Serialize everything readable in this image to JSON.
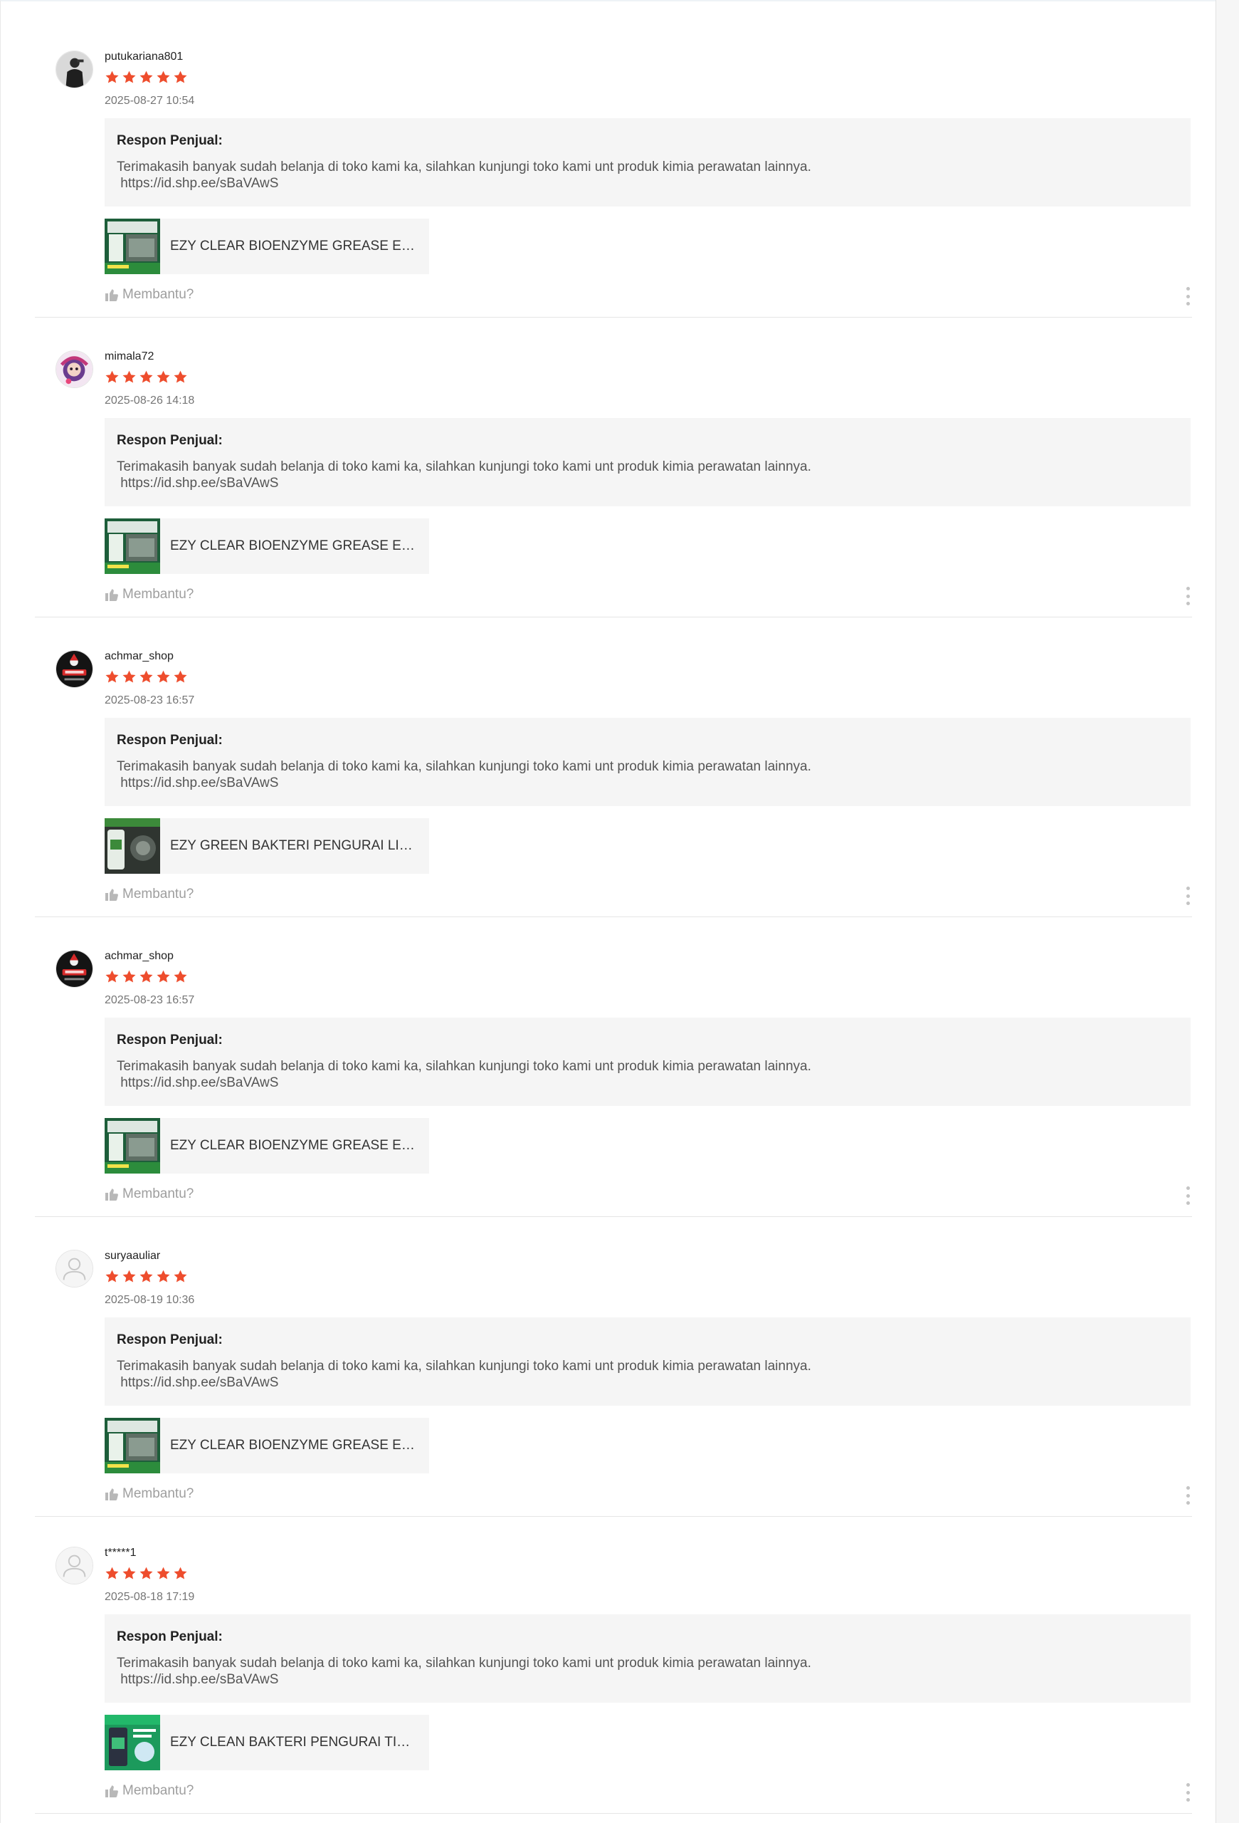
{
  "colors": {
    "star": "#ee4d2d",
    "response_bg": "#f5f5f5",
    "divider": "#e5e5e5",
    "muted_text": "#9e9e9e"
  },
  "reviews": [
    {
      "username": "putukariana801",
      "rating": 5,
      "timestamp": "2025-08-27 10:54",
      "response_title": "Respon Penjual:",
      "response_text": "Terimakasih banyak sudah belanja di toko kami ka, silahkan kunjungi toko kami unt produk kimia perawatan lainnya.\n https://id.shp.ee/sBaVAwS",
      "product_name": "EZY CLEAR BIOENZYME GREASE EATER",
      "helpful_label": "Membantu?",
      "avatar_icon": "person-photo-icon",
      "thumb_icon": "product-ezy-clear-icon"
    },
    {
      "username": "mimala72",
      "rating": 5,
      "timestamp": "2025-08-26 14:18",
      "response_title": "Respon Penjual:",
      "response_text": "Terimakasih banyak sudah belanja di toko kami ka, silahkan kunjungi toko kami unt produk kimia perawatan lainnya.\n https://id.shp.ee/sBaVAwS",
      "product_name": "EZY CLEAR BIOENZYME GREASE EATER",
      "helpful_label": "Membantu?",
      "avatar_icon": "character-avatar-icon",
      "thumb_icon": "product-ezy-clear-icon"
    },
    {
      "username": "achmar_shop",
      "rating": 5,
      "timestamp": "2025-08-23 16:57",
      "response_title": "Respon Penjual:",
      "response_text": "Terimakasih banyak sudah belanja di toko kami ka, silahkan kunjungi toko kami unt produk kimia perawatan lainnya.\n https://id.shp.ee/sBaVAwS",
      "product_name": "EZY GREEN BAKTERI PENGURAI LIMBAH",
      "helpful_label": "Membantu?",
      "avatar_icon": "shop-logo-icon",
      "thumb_icon": "product-ezy-green-icon"
    },
    {
      "username": "achmar_shop",
      "rating": 5,
      "timestamp": "2025-08-23 16:57",
      "response_title": "Respon Penjual:",
      "response_text": "Terimakasih banyak sudah belanja di toko kami ka, silahkan kunjungi toko kami unt produk kimia perawatan lainnya.\n https://id.shp.ee/sBaVAwS",
      "product_name": "EZY CLEAR BIOENZYME GREASE EATER",
      "helpful_label": "Membantu?",
      "avatar_icon": "shop-logo-icon",
      "thumb_icon": "product-ezy-clear-icon"
    },
    {
      "username": "suryaauliar",
      "rating": 5,
      "timestamp": "2025-08-19 10:36",
      "response_title": "Respon Penjual:",
      "response_text": "Terimakasih banyak sudah belanja di toko kami ka, silahkan kunjungi toko kami unt produk kimia perawatan lainnya.\n https://id.shp.ee/sBaVAwS",
      "product_name": "EZY CLEAR BIOENZYME GREASE EATER",
      "helpful_label": "Membantu?",
      "avatar_icon": "default-user-icon",
      "thumb_icon": "product-ezy-clear-icon"
    },
    {
      "username": "t*****1",
      "rating": 5,
      "timestamp": "2025-08-18 17:19",
      "response_title": "Respon Penjual:",
      "response_text": "Terimakasih banyak sudah belanja di toko kami ka, silahkan kunjungi toko kami unt produk kimia perawatan lainnya.\n https://id.shp.ee/sBaVAwS",
      "product_name": "EZY CLEAN BAKTERI PENGURAI TINJA",
      "helpful_label": "Membantu?",
      "avatar_icon": "default-user-icon",
      "thumb_icon": "product-ezy-clean-icon"
    }
  ]
}
